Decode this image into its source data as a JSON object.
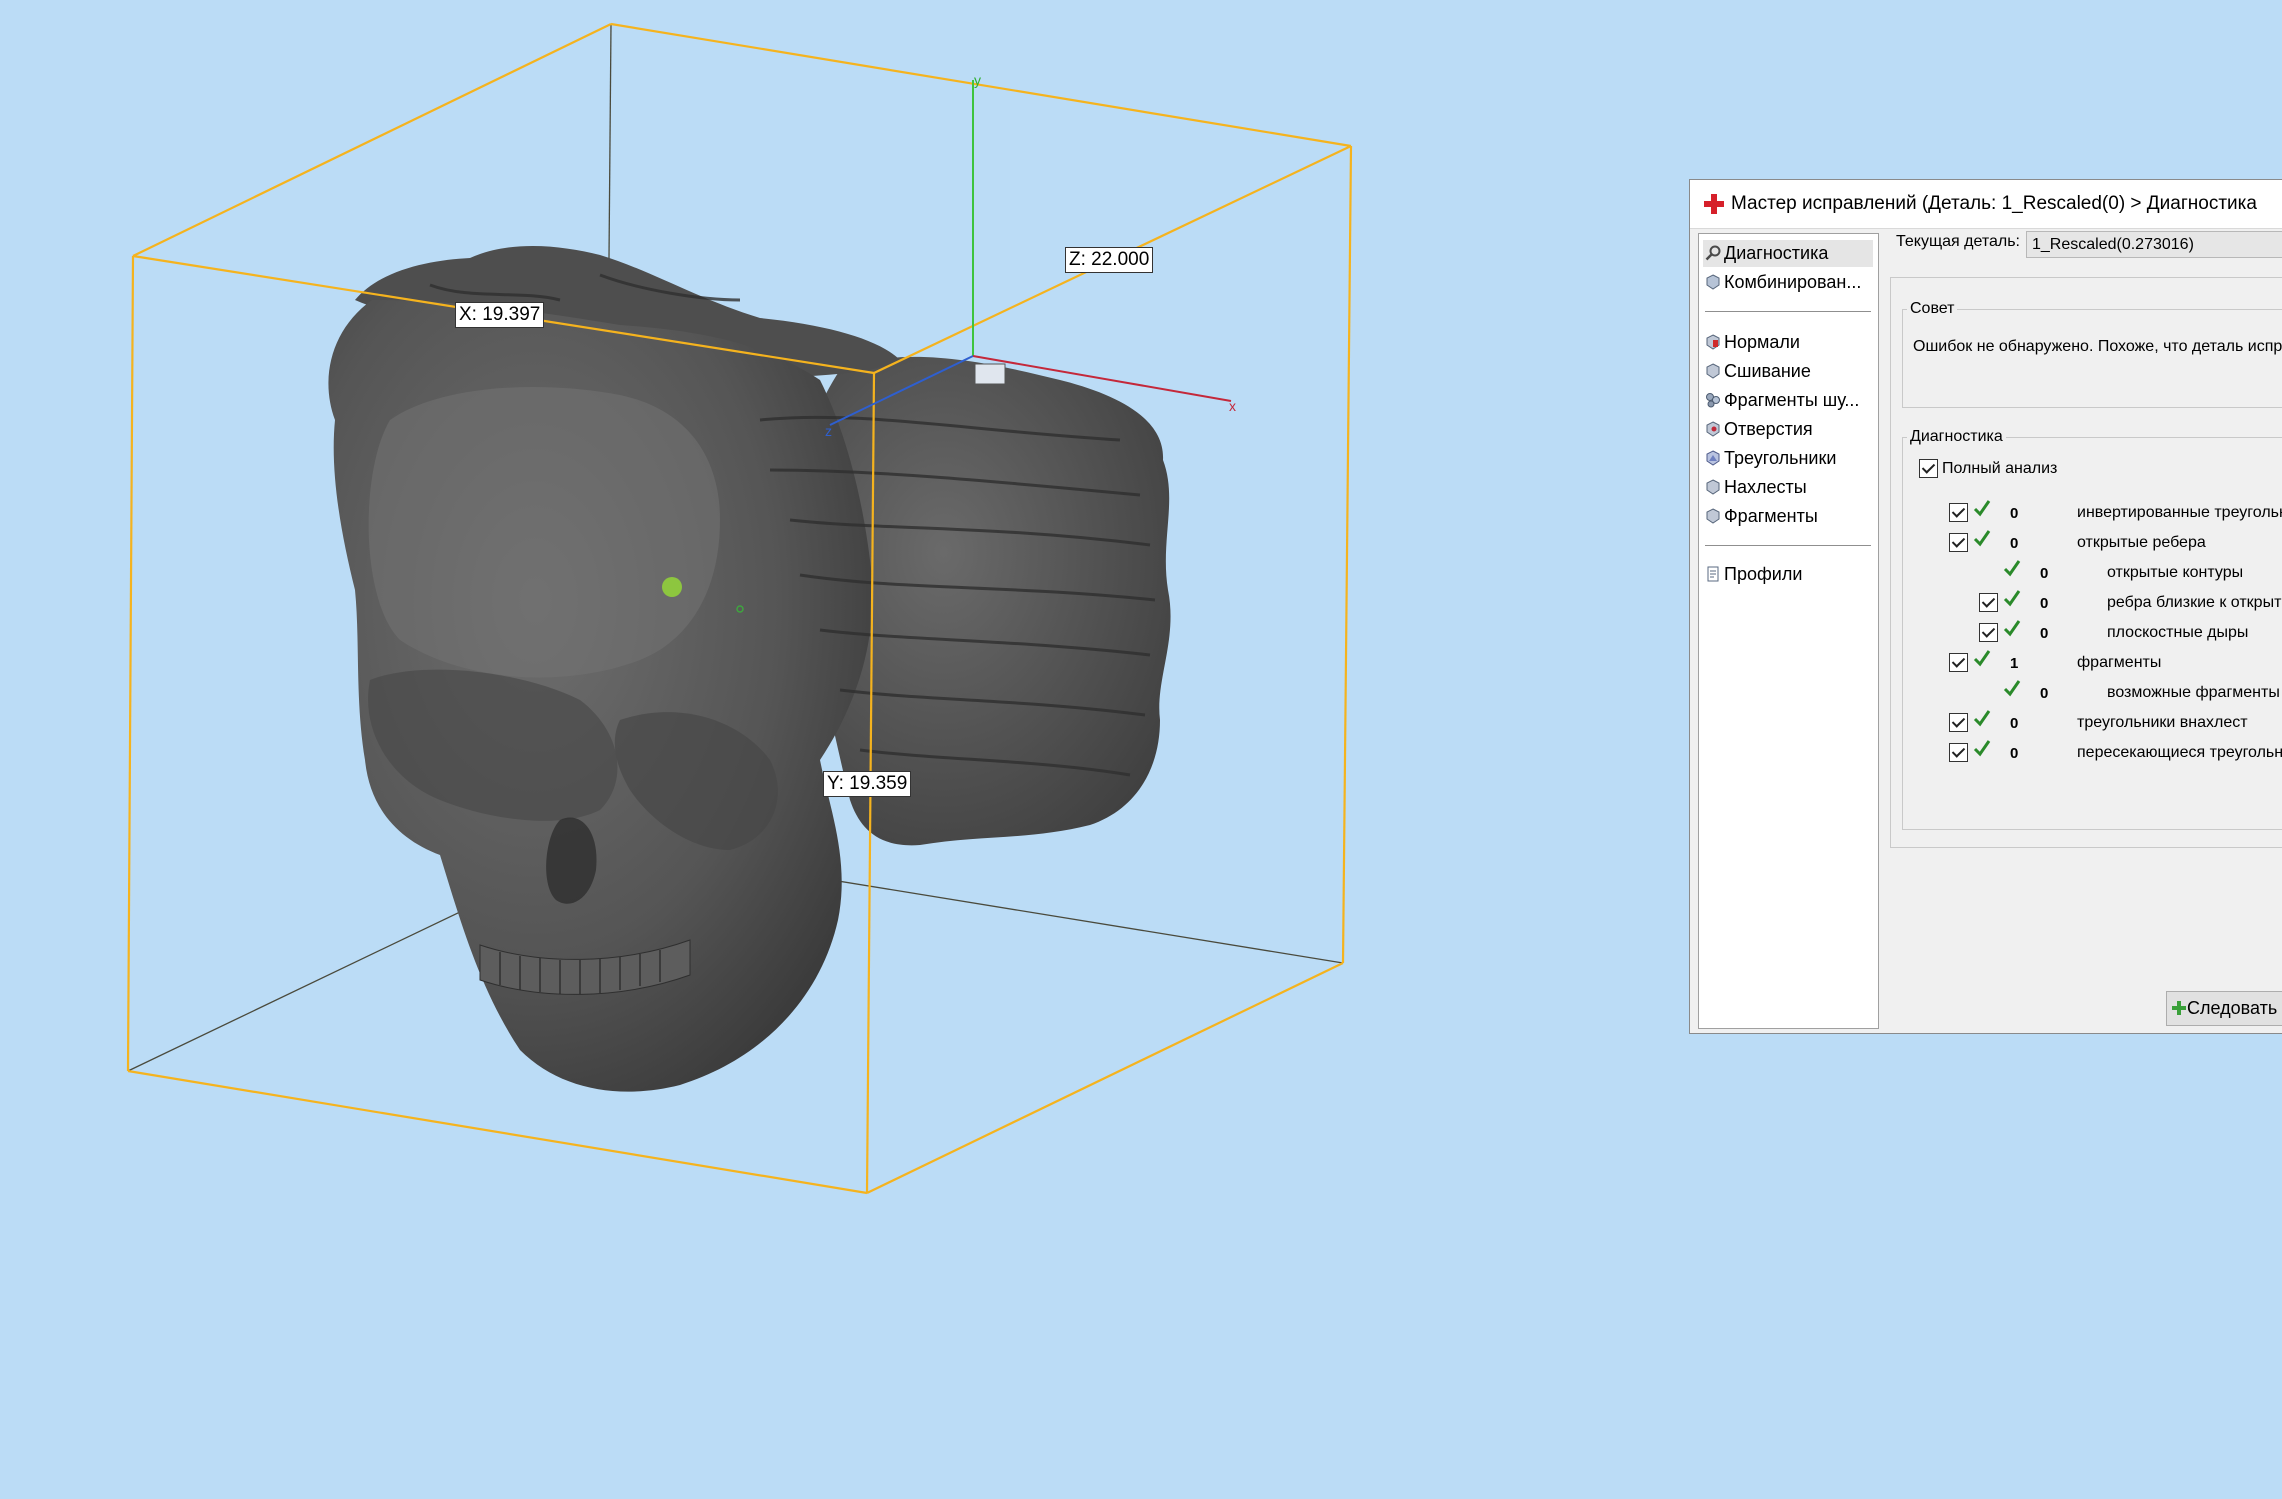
{
  "viewport": {
    "dim_x": "X: 19.397",
    "dim_y": "Y: 19.359",
    "dim_z": "Z: 22.000",
    "axis_x": "x",
    "axis_y": "y",
    "axis_z": "z",
    "bounding_box_color": "#f5b31e",
    "model_color": "#5a5a5a"
  },
  "dialog": {
    "title": "Мастер исправлений (Деталь: 1_Rescaled(0) > Диагностика",
    "nav": [
      {
        "label": "Диагностика",
        "icon": "magnifier-icon",
        "selected": true
      },
      {
        "label": "Комбинирован...",
        "icon": "cube-icon"
      },
      {
        "label": "Нормали",
        "icon": "normals-icon"
      },
      {
        "label": "Сшивание",
        "icon": "stitch-icon"
      },
      {
        "label": "Фрагменты шу...",
        "icon": "noise-shells-icon"
      },
      {
        "label": "Отверстия",
        "icon": "holes-icon"
      },
      {
        "label": "Треугольники",
        "icon": "triangles-icon"
      },
      {
        "label": "Нахлесты",
        "icon": "overlaps-icon"
      },
      {
        "label": "Фрагменты",
        "icon": "shells-icon"
      },
      {
        "label": "Профили",
        "icon": "profile-icon"
      }
    ],
    "current_part_label": "Текущая деталь:",
    "current_part_value": "1_Rescaled(0.273016)",
    "advice_legend": "Совет",
    "advice_text": "Ошибок не обнаружено. Похоже, что деталь испр",
    "diagnostics_legend": "Диагностика",
    "full_analysis": "Полный анализ",
    "rows": [
      {
        "count": "0",
        "label": "инвертированные треугольн"
      },
      {
        "count": "0",
        "label": "открытые ребера"
      },
      {
        "count": "0",
        "label": "открытые контуры"
      },
      {
        "count": "0",
        "label": "ребра близкие к открыт"
      },
      {
        "count": "0",
        "label": "плоскостные дыры"
      },
      {
        "count": "1",
        "label": "фрагменты"
      },
      {
        "count": "0",
        "label": "возможные фрагменты"
      },
      {
        "count": "0",
        "label": "треугольники внахлест"
      },
      {
        "count": "0",
        "label": "пересекающиеся треугольн"
      }
    ],
    "fix_button": "Следовать р"
  }
}
